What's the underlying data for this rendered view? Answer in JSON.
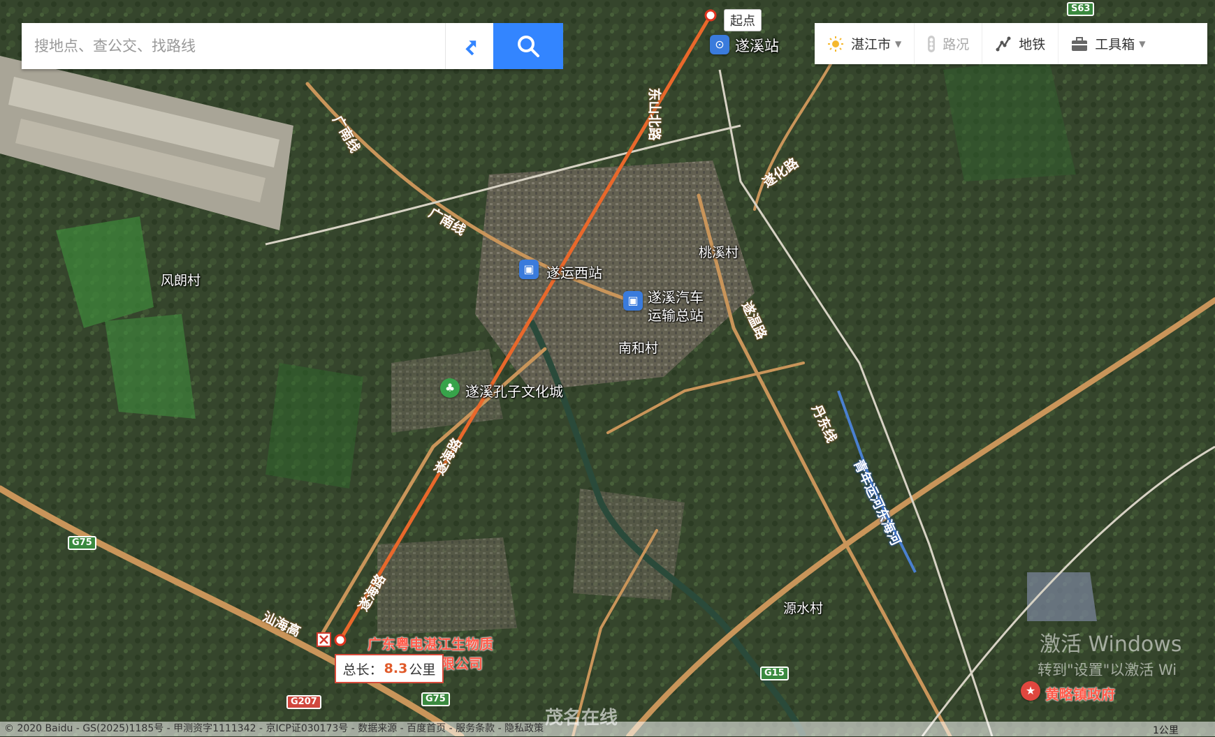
{
  "search": {
    "placeholder": "搜地点、查公交、找路线"
  },
  "toolbar": {
    "city": "湛江市",
    "traffic": "路况",
    "subway": "地铁",
    "tools": "工具箱"
  },
  "route": {
    "start_tag": "起点",
    "distance_label": "总长：",
    "distance_value": "8.3",
    "distance_unit": "公里"
  },
  "places": {
    "suixi_station": "遂溪站",
    "suiyun_west": "遂运西站",
    "suixi_bus_line1": "遂溪汽车",
    "suixi_bus_line2": "运输总站",
    "taoxi": "桃溪村",
    "nanhe": "南和村",
    "fenglang": "风朗村",
    "confucius": "遂溪孔子文化城",
    "yuanshui": "源水村",
    "company_line1": "广东粤电湛江生物质",
    "company_line2": "限公司",
    "huanglue": "黄略镇政府"
  },
  "roads": {
    "dongshan": "东山北路",
    "suihua": "遂化路",
    "guangnan1": "广南线",
    "guangnan2": "广南线",
    "suiwen": "遂温路",
    "suihai1": "遂海路",
    "suihai2": "遂海路",
    "dandong": "丹东线",
    "qingnian": "青年运河东海河",
    "shanhai": "汕海高"
  },
  "shields": {
    "s63": "S63",
    "g75a": "G75",
    "g75b": "G75",
    "g207": "G207",
    "g15": "G15"
  },
  "overlay": {
    "activate1": "激活 Windows",
    "activate2": "转到\"设置\"以激活 Wi",
    "brand": "茂名在线",
    "copyright": "© 2020 Baidu - GS(2025)1185号 - 甲测资字1111342 - 京ICP证030173号 - 数据来源 - 百度首页 - 服务条款 - 隐私政策",
    "scale": "1公里"
  },
  "colors": {
    "route": "#e9682b",
    "search_button": "#3385ff",
    "road": "#c9955a"
  }
}
